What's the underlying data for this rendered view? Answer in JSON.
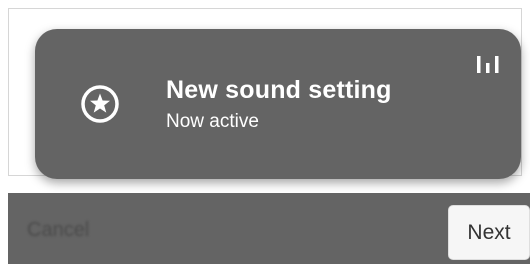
{
  "notification": {
    "title": "New sound setting",
    "subtitle": "Now active",
    "icon": "star-circle-icon",
    "status_icon": "signal-bars-icon"
  },
  "footer": {
    "cancel_label": "Cancel",
    "next_label": "Next"
  },
  "colors": {
    "toast_background": "#646464",
    "toast_text": "#ffffff",
    "footer_background": "#646464",
    "next_button_background": "#f6f6f6"
  }
}
